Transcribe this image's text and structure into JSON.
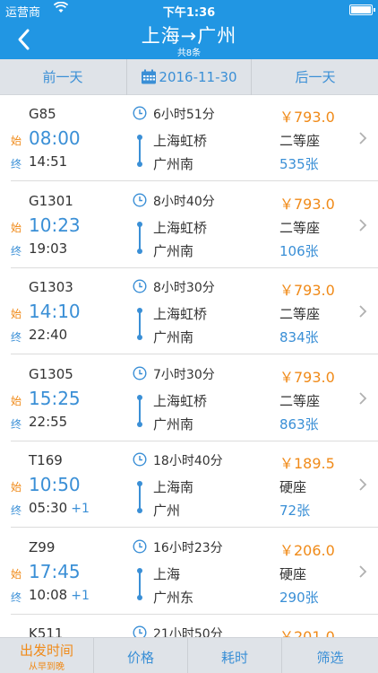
{
  "status_bar": {
    "carrier": "运营商",
    "time": "下午1:36"
  },
  "nav": {
    "title": "上海→广州",
    "subtitle": "共8条"
  },
  "date_bar": {
    "prev_label": "前一天",
    "current_date": "2016-11-30",
    "next_label": "后一天"
  },
  "tags": {
    "start": "始",
    "end": "终"
  },
  "trains": [
    {
      "number": "G85",
      "depart_time": "08:00",
      "arrive_time": "14:51",
      "plus_day": "",
      "duration": "6小时51分",
      "from_station": "上海虹桥",
      "to_station": "广州南",
      "price": "￥793.0",
      "seat_type": "二等座",
      "remaining": "535张"
    },
    {
      "number": "G1301",
      "depart_time": "10:23",
      "arrive_time": "19:03",
      "plus_day": "",
      "duration": "8小时40分",
      "from_station": "上海虹桥",
      "to_station": "广州南",
      "price": "￥793.0",
      "seat_type": "二等座",
      "remaining": "106张"
    },
    {
      "number": "G1303",
      "depart_time": "14:10",
      "arrive_time": "22:40",
      "plus_day": "",
      "duration": "8小时30分",
      "from_station": "上海虹桥",
      "to_station": "广州南",
      "price": "￥793.0",
      "seat_type": "二等座",
      "remaining": "834张"
    },
    {
      "number": "G1305",
      "depart_time": "15:25",
      "arrive_time": "22:55",
      "plus_day": "",
      "duration": "7小时30分",
      "from_station": "上海虹桥",
      "to_station": "广州南",
      "price": "￥793.0",
      "seat_type": "二等座",
      "remaining": "863张"
    },
    {
      "number": "T169",
      "depart_time": "10:50",
      "arrive_time": "05:30",
      "plus_day": "+1",
      "duration": "18小时40分",
      "from_station": "上海南",
      "to_station": "广州",
      "price": "￥189.5",
      "seat_type": "硬座",
      "remaining": "72张"
    },
    {
      "number": "Z99",
      "depart_time": "17:45",
      "arrive_time": "10:08",
      "plus_day": "+1",
      "duration": "16小时23分",
      "from_station": "上海",
      "to_station": "广州东",
      "price": "￥206.0",
      "seat_type": "硬座",
      "remaining": "290张"
    },
    {
      "number": "K511",
      "depart_time": "",
      "arrive_time": "",
      "plus_day": "",
      "duration": "21小时50分",
      "from_station": "",
      "to_station": "",
      "price": "￥201.0",
      "seat_type": "",
      "remaining": ""
    }
  ],
  "filter_bar": {
    "departure_label": "出发时间",
    "departure_sub": "从早到晚",
    "price_label": "价格",
    "duration_label": "耗时",
    "filter_label": "筛选"
  },
  "colors": {
    "brand": "#2196e3",
    "accent_orange": "#f08a18",
    "link_blue": "#3a8fd6"
  }
}
